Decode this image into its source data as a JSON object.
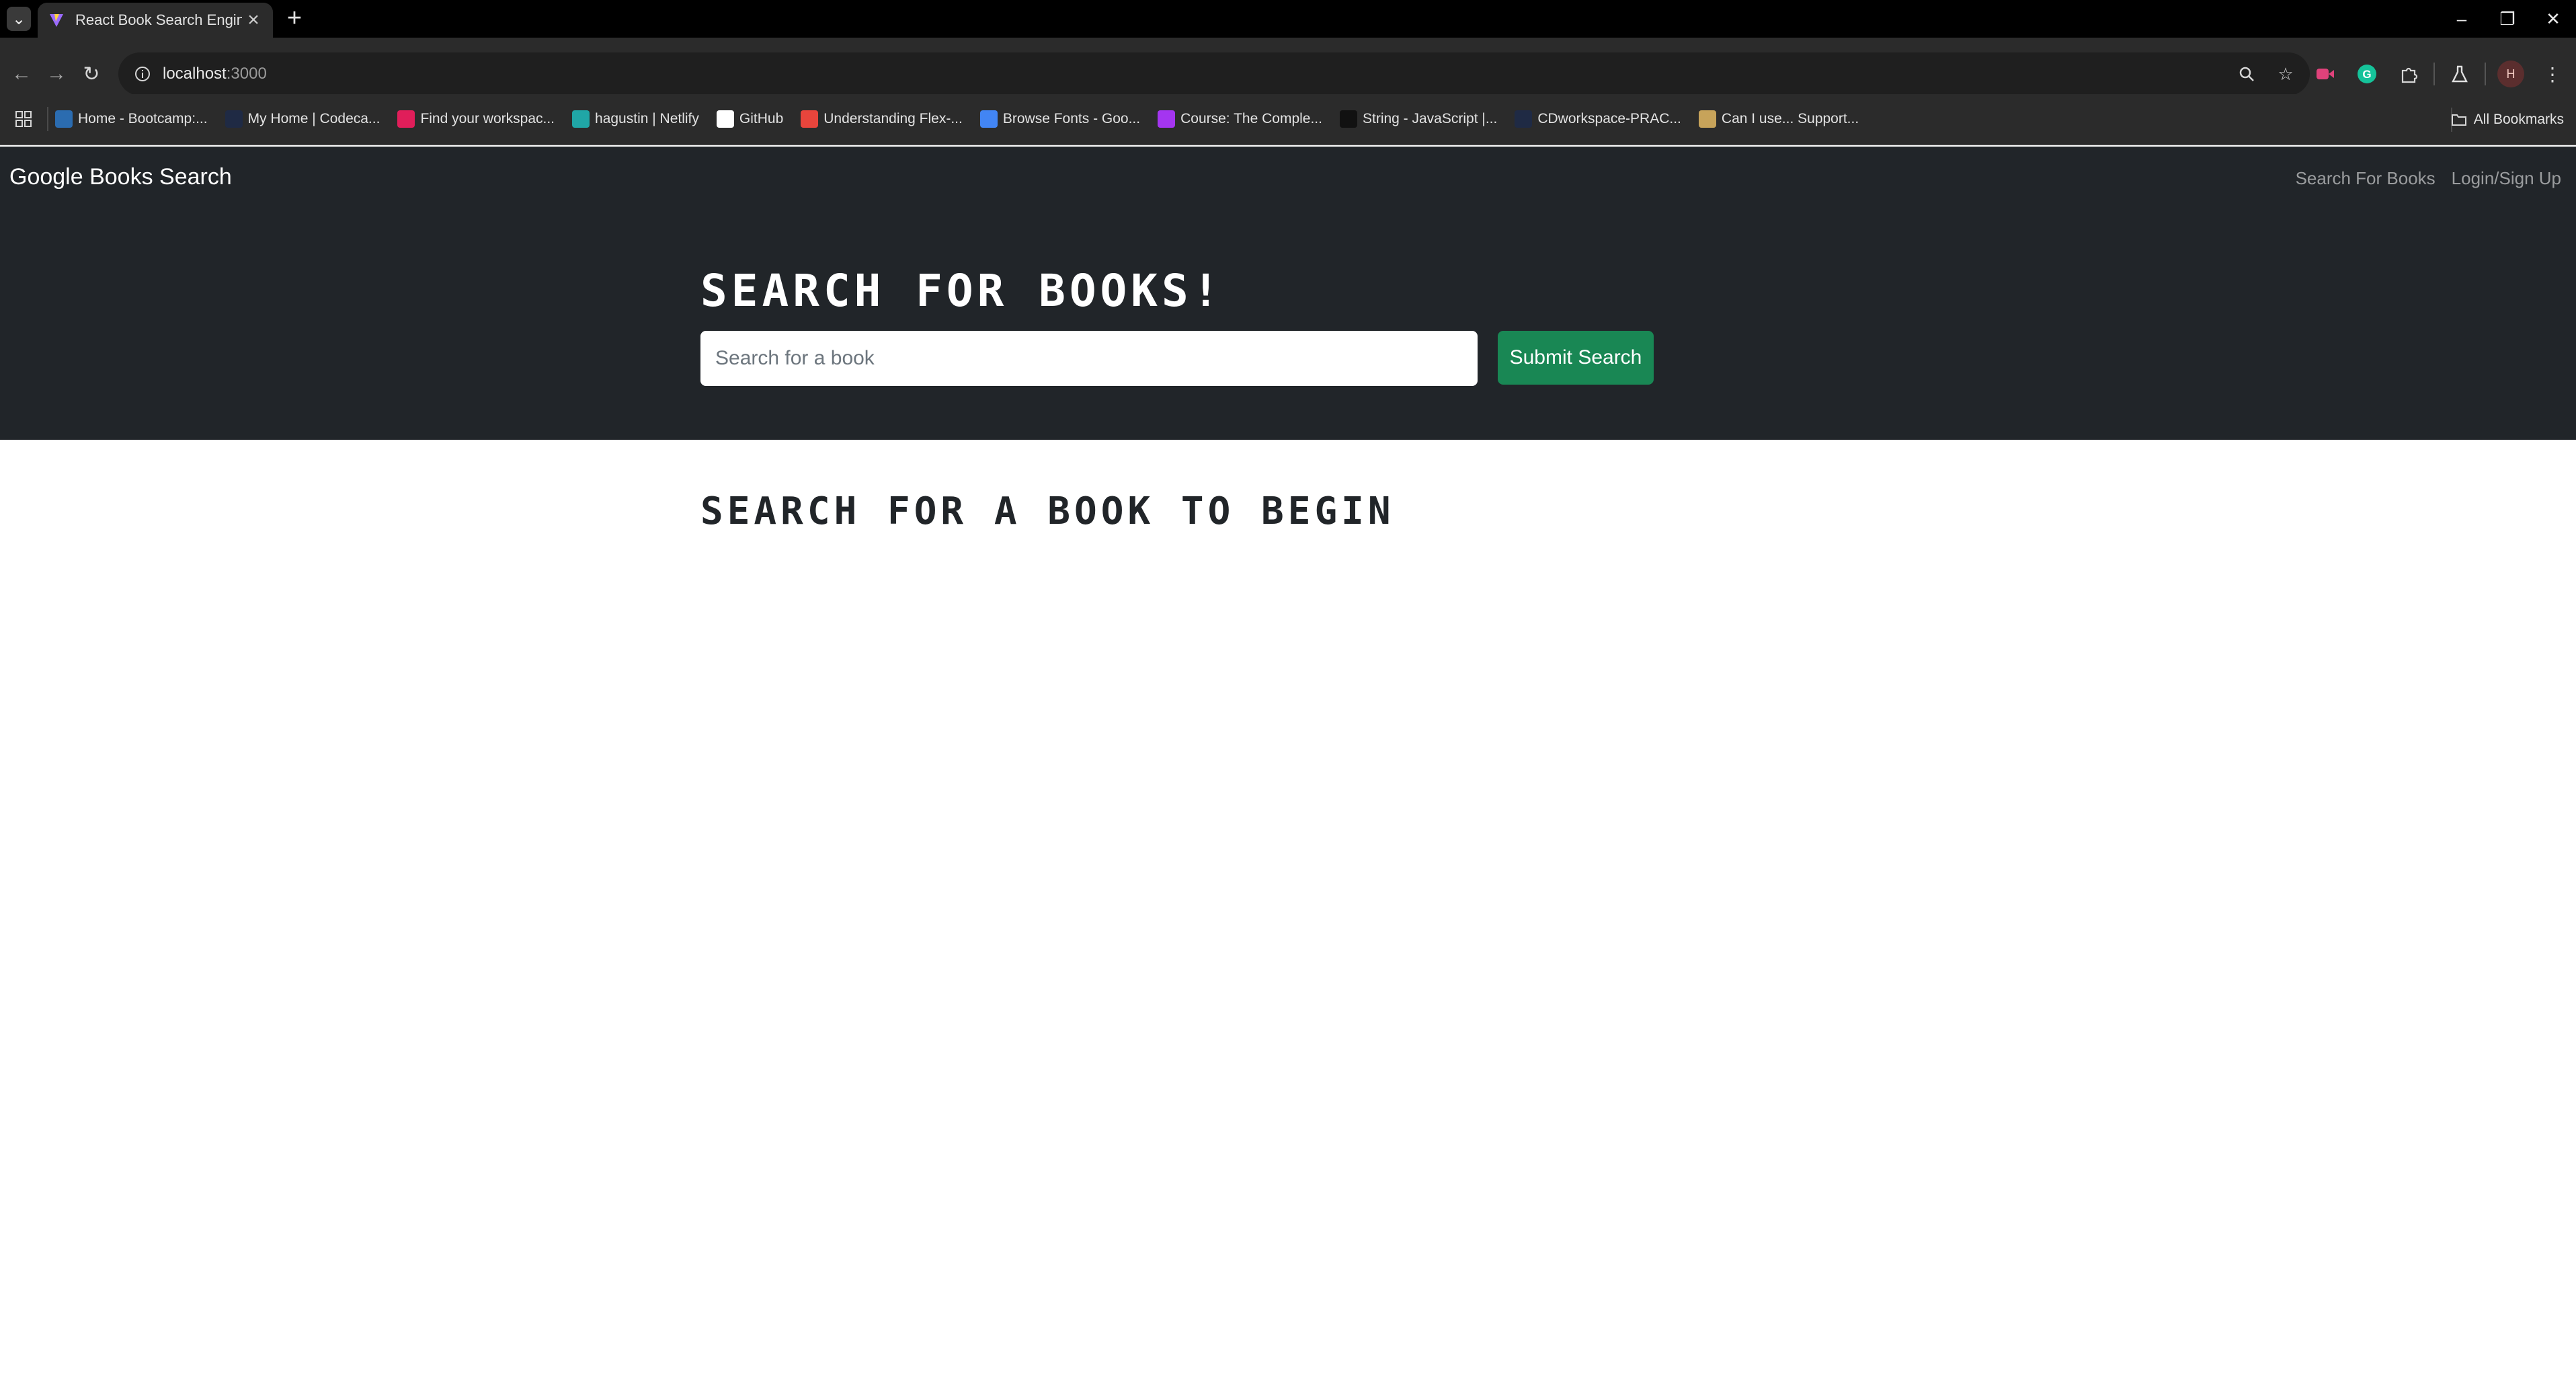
{
  "browser": {
    "tab_title": "React Book Search Engine",
    "url_host": "localhost",
    "url_port": ":3000",
    "bookmarks": [
      {
        "label": "Home - Bootcamp:...",
        "icon": "bootcamp-icon",
        "color": "#2b6cb0"
      },
      {
        "label": "My Home | Codeca...",
        "icon": "codecademy-icon",
        "color": "#1f2a44"
      },
      {
        "label": "Find your workspac...",
        "icon": "slack-icon",
        "color": "#e01e5a"
      },
      {
        "label": "hagustin | Netlify",
        "icon": "netlify-icon",
        "color": "#20a6a6"
      },
      {
        "label": "GitHub",
        "icon": "github-icon",
        "color": "#ffffff"
      },
      {
        "label": "Understanding Flex-...",
        "icon": "asterisk-icon",
        "color": "#e8453c"
      },
      {
        "label": "Browse Fonts - Goo...",
        "icon": "google-fonts-icon",
        "color": "#4285f4"
      },
      {
        "label": "Course: The Comple...",
        "icon": "udemy-icon",
        "color": "#a435f0"
      },
      {
        "label": "String - JavaScript |...",
        "icon": "mdn-icon",
        "color": "#111111"
      },
      {
        "label": "CDworkspace-PRAC...",
        "icon": "workspace-icon",
        "color": "#1f2a44"
      },
      {
        "label": "Can I use... Support...",
        "icon": "caniuse-icon",
        "color": "#c7a35a"
      }
    ],
    "all_bookmarks_label": "All Bookmarks",
    "avatar_initial": "H"
  },
  "app": {
    "brand": "Google Books Search",
    "nav": {
      "search_link": "Search For Books",
      "login_link": "Login/Sign Up"
    },
    "hero": {
      "title": "Search for Books!",
      "search_placeholder": "Search for a book",
      "submit_label": "Submit Search"
    },
    "results_heading": "Search for a book to begin"
  },
  "colors": {
    "navbar_bg": "#212529",
    "submit_button": "#198754",
    "chrome_bg": "#2b2b2b"
  }
}
